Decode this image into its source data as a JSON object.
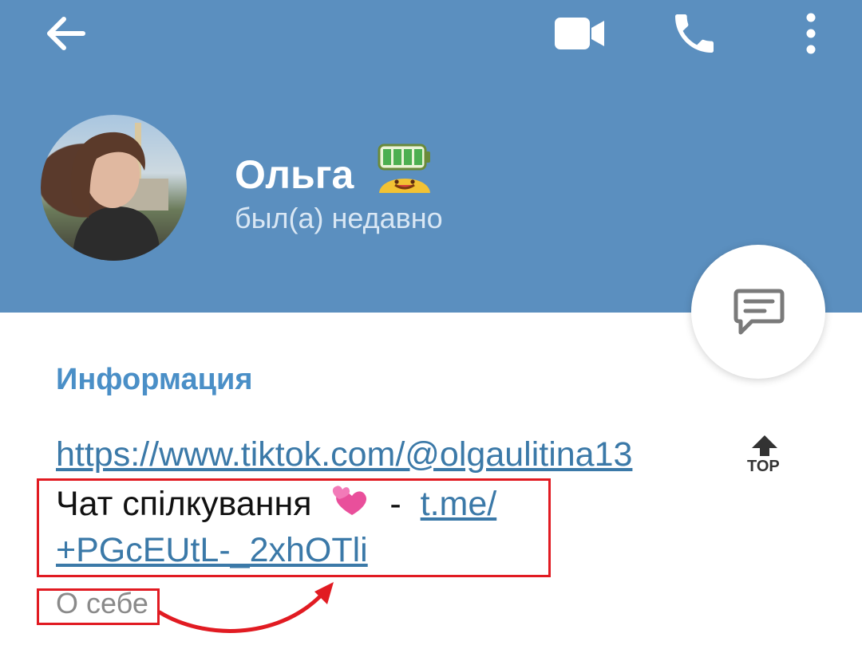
{
  "header": {
    "name": "Ольга",
    "status": "был(а) недавно"
  },
  "info": {
    "section_title": "Информация",
    "tiktok_link": "https://www.tiktok.com/@olgaulitina13",
    "chat_prefix": "Чат спілкування",
    "chat_separator": " - ",
    "chat_link_part1": "t.me/",
    "chat_link_part2": "+PGcEUtL-_2xhOTli",
    "about_label": "О себе",
    "top_badge": "TOP"
  },
  "annotation": {
    "color": "#e11b22"
  },
  "colors": {
    "header_bg": "#5b8fbf",
    "accent": "#4a8fc7",
    "link": "#3b79a8"
  }
}
